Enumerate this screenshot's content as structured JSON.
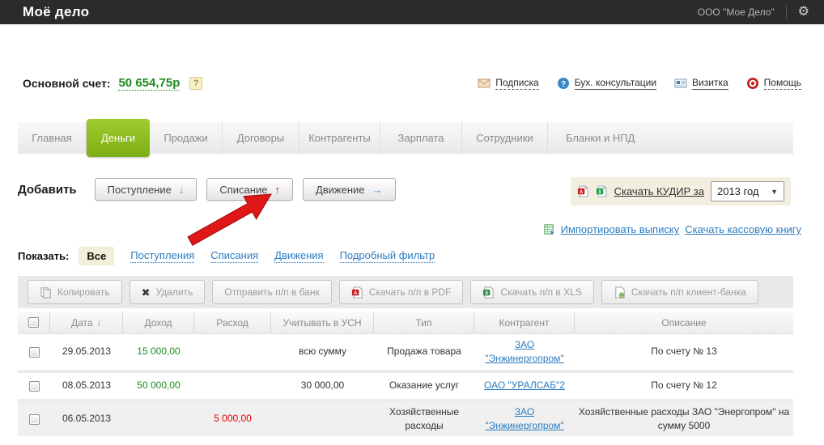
{
  "topbar": {
    "logo": "Моё дело",
    "company": "ООО \"Мое Дело\""
  },
  "account": {
    "label": "Основной счет:",
    "value": "50 654,75р",
    "help_badge": "?"
  },
  "quick_links": [
    {
      "label": "Подписка"
    },
    {
      "label": "Бух. консультации"
    },
    {
      "label": "Визитка"
    },
    {
      "label": "Помощь"
    }
  ],
  "tabs": [
    {
      "label": "Главная"
    },
    {
      "label": "Деньги"
    },
    {
      "label": "Продажи"
    },
    {
      "label": "Договоры"
    },
    {
      "label": "Контрагенты"
    },
    {
      "label": "Зарплата"
    },
    {
      "label": "Сотрудники"
    },
    {
      "label": "Бланки и НПД"
    }
  ],
  "add_section": {
    "label": "Добавить",
    "buttons": [
      {
        "label": "Поступление",
        "arrow": "↓"
      },
      {
        "label": "Списание",
        "arrow": "↑"
      },
      {
        "label": "Движение",
        "arrow": "→"
      }
    ]
  },
  "kudir": {
    "link_label": "Скачать КУДИР за",
    "year_select": "2013 год",
    "caret": "▼"
  },
  "secondary_links": {
    "import_statement": "Импортировать выписку",
    "cash_book": "Скачать кассовую книгу"
  },
  "filter": {
    "label": "Показать:",
    "active_item": "Все",
    "links": [
      "Поступления",
      "Списания",
      "Движения",
      "Подробный фильтр"
    ]
  },
  "toolbar": {
    "buttons": [
      "Копировать",
      "Удалить",
      "Отправить п/п в банк",
      "Скачать п/п в PDF",
      "Скачать п/п в XLS",
      "Скачать п/п клиент-банка"
    ],
    "delete_icon": "✖"
  },
  "table": {
    "headers": [
      {
        "label": "Дата",
        "sort": "↓"
      },
      {
        "label": "Доход"
      },
      {
        "label": "Расход"
      },
      {
        "label": "Учитывать в УСН"
      },
      {
        "label": "Тип"
      },
      {
        "label": "Контрагент"
      },
      {
        "label": "Описание"
      }
    ],
    "rows": [
      {
        "date": "29.05.2013",
        "income": "15 000,00",
        "expense": "",
        "usn": "всю сумму",
        "type": "Продажа товара",
        "contractor": "ЗАО \"Энжинергопром\"",
        "description": "По счету № 13"
      },
      {
        "date": "08.05.2013",
        "income": "50 000,00",
        "expense": "",
        "usn": "30 000,00",
        "type": "Оказание услуг",
        "contractor": "ОАО \"УРАЛСАБ\"2",
        "description": "По счету № 12"
      },
      {
        "date": "06.05.2013",
        "income": "",
        "expense": "5 000,00",
        "usn": "",
        "type": "Хозяйственные расходы",
        "contractor": "ЗАО \"Энжинергопром\"",
        "description": "Хозяйственные расходы ЗАО \"Энергопром\" на сумму 5000"
      }
    ]
  },
  "colors": {
    "accent_green": "#8fc21e",
    "money_income": "#1e8a1e",
    "money_expense": "#e00000",
    "link_blue": "#2b7cc0",
    "topbar_bg": "#2b2b2b",
    "highlight_beige": "#f2eee0"
  }
}
